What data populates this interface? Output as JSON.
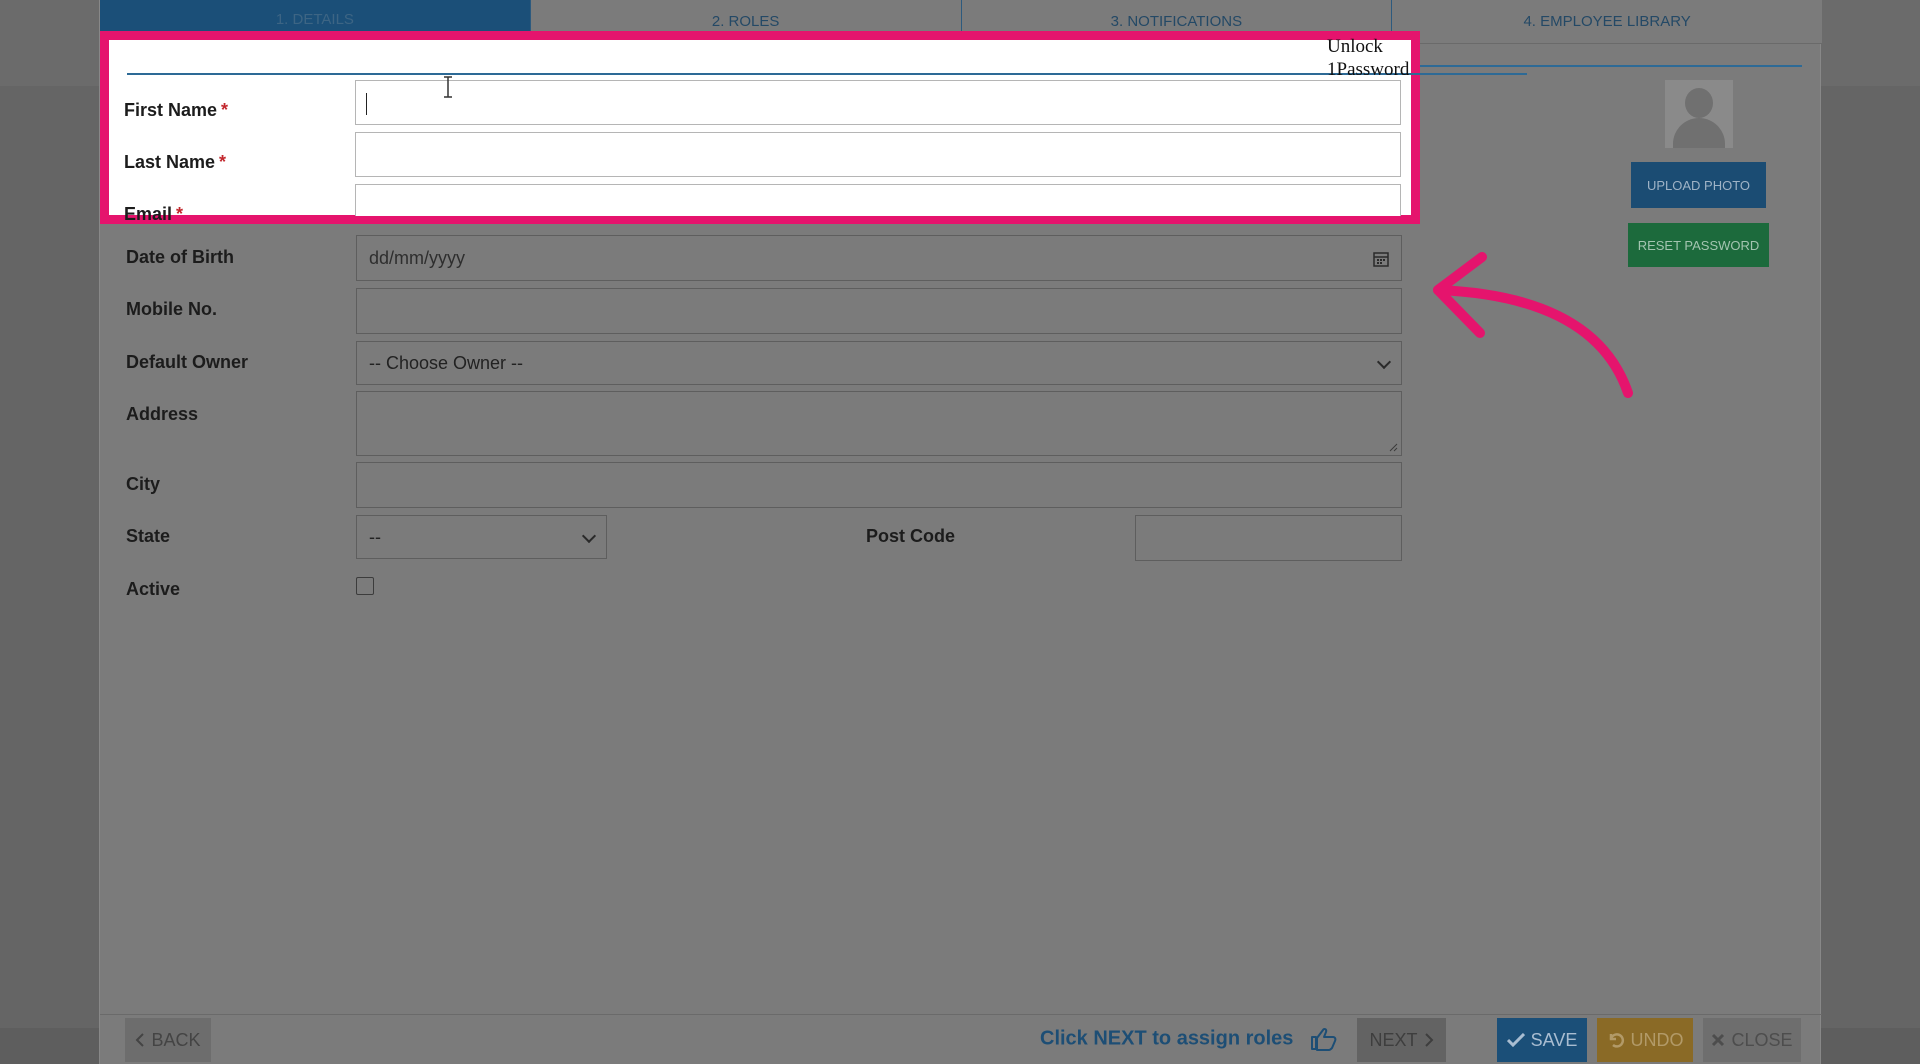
{
  "tabs": [
    {
      "label": "1. DETAILS"
    },
    {
      "label": "2. ROLES"
    },
    {
      "label": "3. NOTIFICATIONS"
    },
    {
      "label": "4. EMPLOYEE LIBRARY"
    }
  ],
  "form": {
    "first_name_label": "First Name",
    "last_name_label": "Last Name",
    "email_label": "Email",
    "required_mark": "*",
    "dob_label": "Date of Birth",
    "dob_placeholder": "dd/mm/yyyy",
    "mobile_label": "Mobile No.",
    "owner_label": "Default Owner",
    "owner_value": "-- Choose Owner --",
    "address_label": "Address",
    "city_label": "City",
    "state_label": "State",
    "state_value": "--",
    "postcode_label": "Post Code",
    "active_label": "Active"
  },
  "overlay": {
    "unlock_line1": "Unlock",
    "unlock_line2": "1Password"
  },
  "sidebar": {
    "upload_label": "UPLOAD PHOTO",
    "reset_label": "RESET PASSWORD"
  },
  "footer": {
    "back_label": "BACK",
    "hint": "Click NEXT to assign roles",
    "next_label": "NEXT",
    "save_label": "SAVE",
    "undo_label": "UNDO",
    "close_label": "CLOSE"
  },
  "colors": {
    "highlight": "#e5146d",
    "primary": "#1b4f78",
    "success": "#1c6a3c",
    "warning": "#8a6a26"
  }
}
